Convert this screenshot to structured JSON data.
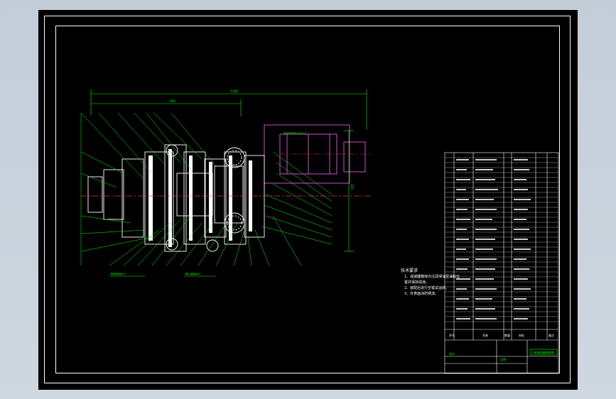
{
  "drawing": {
    "overall_dimension": "1,445",
    "sub_dimension": "500",
    "height_dimension": "320",
    "motor_callout": "电机型号YB2-90S-4",
    "left_callout_1": "输出轴径φ75",
    "left_callout_2": "输入轴径φ40"
  },
  "technical_requirements": {
    "title": "技术要求",
    "lines": [
      "1、减速器箱体内注润滑油至油标位",
      "   置并保持润滑。",
      "2、装配后进行空载试运转。",
      "3、外表面涂防锈漆。"
    ]
  },
  "title_block": {
    "header": [
      "序号",
      "名称",
      "数量",
      "材料",
      "备注"
    ],
    "drawing_name": "行星减速器装配图",
    "green_label": "设计",
    "scale_label": "比例"
  },
  "colors": {
    "canvas": "#000000",
    "frame": "#ffffff",
    "leader": "#00ff00",
    "part": "#ffffff",
    "center_line": "#ff3030",
    "motor": "#ff66ff",
    "dimension": "#00ff00"
  }
}
